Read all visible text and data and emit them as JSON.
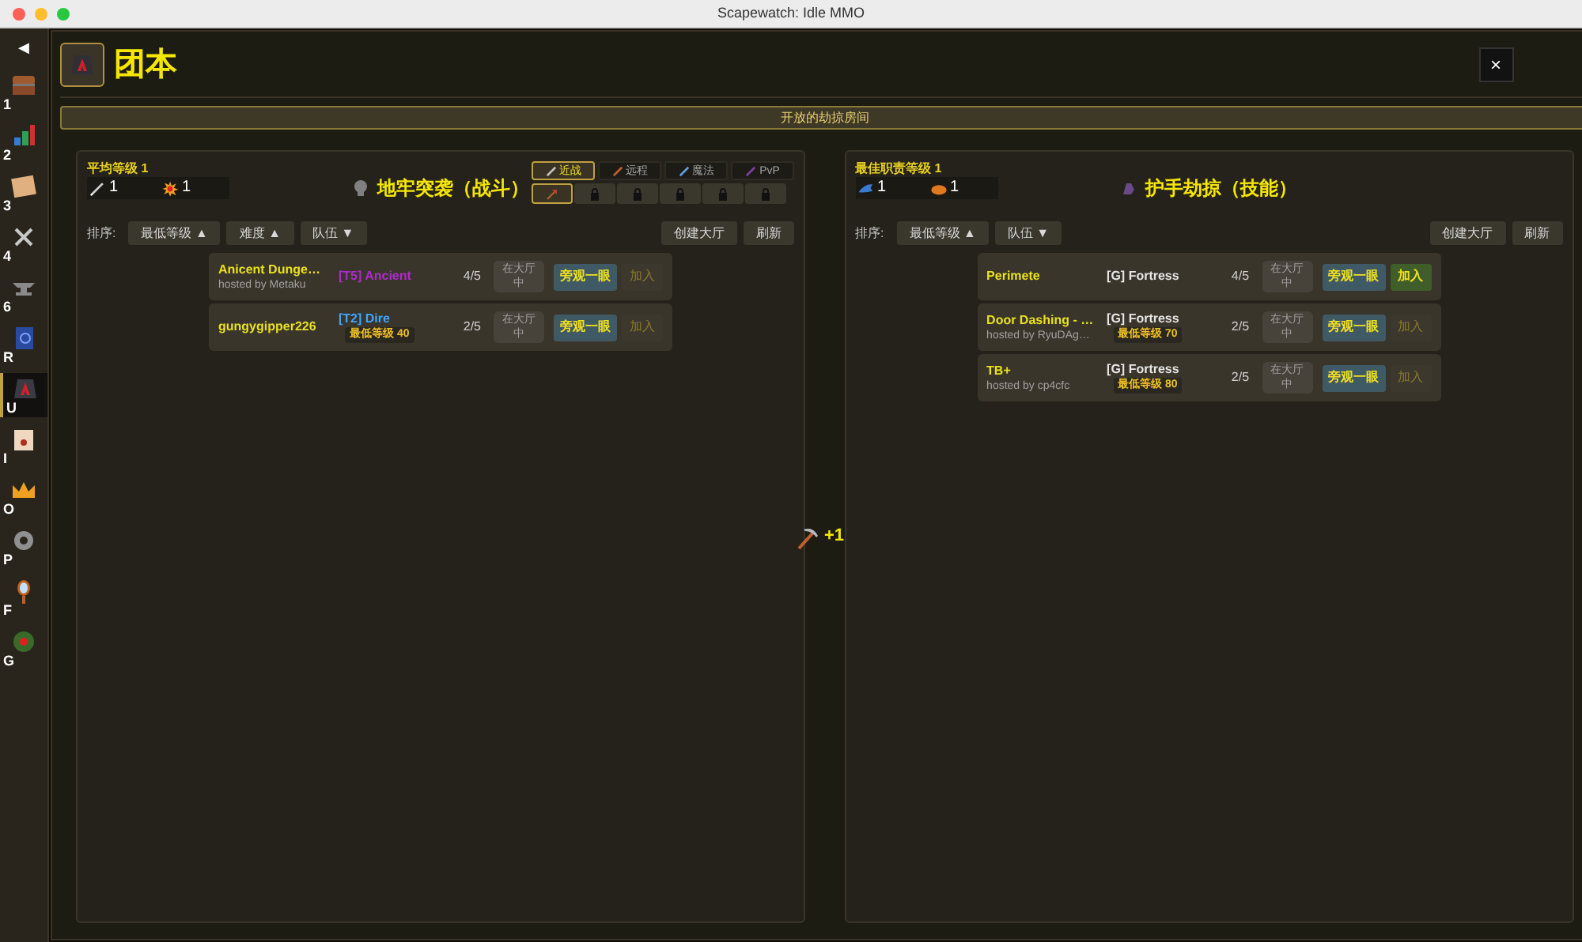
{
  "window": {
    "title": "Scapewatch: Idle MMO"
  },
  "sidebar": {
    "back": "◀",
    "items": [
      {
        "key": "1",
        "selected": false
      },
      {
        "key": "2",
        "selected": false
      },
      {
        "key": "3",
        "selected": false
      },
      {
        "key": "4",
        "selected": false
      },
      {
        "key": "6",
        "selected": false
      },
      {
        "key": "R",
        "selected": false
      },
      {
        "key": "U",
        "selected": true
      },
      {
        "key": "I",
        "selected": false
      },
      {
        "key": "O",
        "selected": false
      },
      {
        "key": "P",
        "selected": false
      },
      {
        "key": "F",
        "selected": false
      },
      {
        "key": "G",
        "selected": false
      }
    ]
  },
  "header": {
    "title": "团本",
    "close": "×"
  },
  "banner": "开放的劫掠房间",
  "center_bonus": "+1",
  "panels": [
    {
      "stat_label": "平均等级 1",
      "stats": [
        "1",
        "1"
      ],
      "title": "地牢突袭（战斗）",
      "tabs": [
        {
          "label": "近战",
          "selected": true
        },
        {
          "label": "远程",
          "selected": false
        },
        {
          "label": "魔法",
          "selected": false
        },
        {
          "label": "PvP",
          "selected": false
        }
      ],
      "slots": [
        {
          "locked": false,
          "selected": true
        },
        {
          "locked": true,
          "selected": false
        },
        {
          "locked": true,
          "selected": false
        },
        {
          "locked": true,
          "selected": false
        },
        {
          "locked": true,
          "selected": false
        },
        {
          "locked": true,
          "selected": false
        }
      ],
      "sort_label": "排序:",
      "sorts": [
        {
          "label": "最低等级",
          "arrow": "▲"
        },
        {
          "label": "难度",
          "arrow": "▲"
        },
        {
          "label": "队伍",
          "arrow": "▼"
        }
      ],
      "actions": [
        "创建大厅",
        "刷新"
      ],
      "rows": [
        {
          "name": "Anicent Dunge…",
          "host": "hosted by Metaku",
          "tier": "[T5] Ancient",
          "color": "#b02ad0",
          "count": "4/5",
          "status": "在大厅中",
          "spectate": "旁观一眼",
          "join": "加入",
          "join_enabled": false
        },
        {
          "name": "gungygipper226",
          "tier": "[T2] Dire",
          "color": "#3ea6ff",
          "min_level": "最低等级 40",
          "count": "2/5",
          "status": "在大厅中",
          "spectate": "旁观一眼",
          "join": "加入",
          "join_enabled": false
        }
      ]
    },
    {
      "stat_label": "最佳职责等级 1",
      "stats": [
        "1",
        "1"
      ],
      "title": "护手劫掠（技能）",
      "sort_label": "排序:",
      "sorts": [
        {
          "label": "最低等级",
          "arrow": "▲"
        },
        {
          "label": "队伍",
          "arrow": "▼"
        }
      ],
      "actions": [
        "创建大厅",
        "刷新"
      ],
      "rows": [
        {
          "name": "Perimete",
          "tier": "[G] Fortress",
          "color": "#e6e6e6",
          "count": "4/5",
          "status": "在大厅中",
          "spectate": "旁观一眼",
          "join": "加入",
          "join_enabled": true
        },
        {
          "name": "Door Dashing - …",
          "host": "hosted by RyuDAg…",
          "tier": "[G] Fortress",
          "color": "#e6e6e6",
          "min_level": "最低等级 70",
          "count": "2/5",
          "status": "在大厅中",
          "spectate": "旁观一眼",
          "join": "加入",
          "join_enabled": false
        },
        {
          "name": "TB+",
          "host": "hosted by cp4cfc",
          "tier": "[G] Fortress",
          "color": "#e6e6e6",
          "min_level": "最低等级 80",
          "count": "2/5",
          "status": "在大厅中",
          "spectate": "旁观一眼",
          "join": "加入",
          "join_enabled": false
        }
      ]
    }
  ]
}
